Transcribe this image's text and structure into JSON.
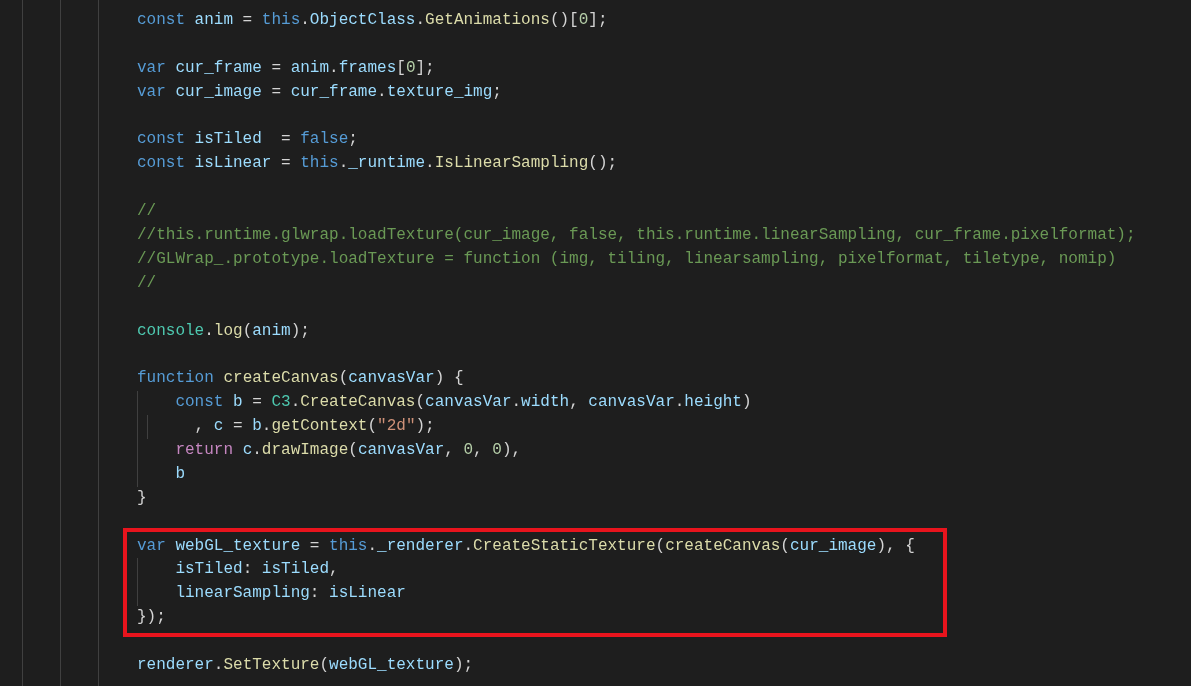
{
  "editor": {
    "blocks": [
      {
        "highlighted": false,
        "lines": [
          {
            "tokens": [
              {
                "kind": "kw",
                "text": "const "
              },
              {
                "kind": "var",
                "text": "anim"
              },
              {
                "kind": "p",
                "text": " = "
              },
              {
                "kind": "kw",
                "text": "this"
              },
              {
                "kind": "p",
                "text": "."
              },
              {
                "kind": "var",
                "text": "ObjectClass"
              },
              {
                "kind": "p",
                "text": "."
              },
              {
                "kind": "fn",
                "text": "GetAnimations"
              },
              {
                "kind": "p",
                "text": "()["
              },
              {
                "kind": "num",
                "text": "0"
              },
              {
                "kind": "p",
                "text": "];"
              }
            ]
          }
        ]
      },
      {
        "highlighted": false,
        "lines": [
          {
            "tokens": [
              {
                "kind": "kw",
                "text": "var "
              },
              {
                "kind": "var",
                "text": "cur_frame"
              },
              {
                "kind": "p",
                "text": " = "
              },
              {
                "kind": "var",
                "text": "anim"
              },
              {
                "kind": "p",
                "text": "."
              },
              {
                "kind": "var",
                "text": "frames"
              },
              {
                "kind": "p",
                "text": "["
              },
              {
                "kind": "num",
                "text": "0"
              },
              {
                "kind": "p",
                "text": "];"
              }
            ]
          },
          {
            "tokens": [
              {
                "kind": "kw",
                "text": "var "
              },
              {
                "kind": "var",
                "text": "cur_image"
              },
              {
                "kind": "p",
                "text": " = "
              },
              {
                "kind": "var",
                "text": "cur_frame"
              },
              {
                "kind": "p",
                "text": "."
              },
              {
                "kind": "var",
                "text": "texture_img"
              },
              {
                "kind": "p",
                "text": ";"
              }
            ]
          }
        ]
      },
      {
        "highlighted": false,
        "lines": [
          {
            "tokens": [
              {
                "kind": "kw",
                "text": "const "
              },
              {
                "kind": "var",
                "text": "isTiled"
              },
              {
                "kind": "p",
                "text": "  = "
              },
              {
                "kind": "kw",
                "text": "false"
              },
              {
                "kind": "p",
                "text": ";"
              }
            ]
          },
          {
            "tokens": [
              {
                "kind": "kw",
                "text": "const "
              },
              {
                "kind": "var",
                "text": "isLinear"
              },
              {
                "kind": "p",
                "text": " = "
              },
              {
                "kind": "kw",
                "text": "this"
              },
              {
                "kind": "p",
                "text": "."
              },
              {
                "kind": "var",
                "text": "_runtime"
              },
              {
                "kind": "p",
                "text": "."
              },
              {
                "kind": "fn",
                "text": "IsLinearSampling"
              },
              {
                "kind": "p",
                "text": "();"
              }
            ]
          }
        ]
      },
      {
        "highlighted": false,
        "lines": [
          {
            "tokens": [
              {
                "kind": "cmt",
                "text": "//"
              }
            ]
          },
          {
            "tokens": [
              {
                "kind": "cmt",
                "text": "//this.runtime.glwrap.loadTexture(cur_image, false, this.runtime.linearSampling, cur_frame.pixelformat);"
              }
            ]
          },
          {
            "tokens": [
              {
                "kind": "cmt",
                "text": "//GLWrap_.prototype.loadTexture = function (img, tiling, linearsampling, pixelformat, tiletype, nomip)"
              }
            ]
          },
          {
            "tokens": [
              {
                "kind": "cmt",
                "text": "//"
              }
            ]
          }
        ]
      },
      {
        "highlighted": false,
        "lines": [
          {
            "tokens": [
              {
                "kind": "type",
                "text": "console"
              },
              {
                "kind": "p",
                "text": "."
              },
              {
                "kind": "fn",
                "text": "log"
              },
              {
                "kind": "p",
                "text": "("
              },
              {
                "kind": "var",
                "text": "anim"
              },
              {
                "kind": "p",
                "text": ");"
              }
            ]
          }
        ]
      },
      {
        "highlighted": false,
        "lines": [
          {
            "tokens": [
              {
                "kind": "kw",
                "text": "function "
              },
              {
                "kind": "fn",
                "text": "createCanvas"
              },
              {
                "kind": "p",
                "text": "("
              },
              {
                "kind": "var",
                "text": "canvasVar"
              },
              {
                "kind": "p",
                "text": ") {"
              }
            ]
          },
          {
            "tokens": [
              {
                "kind": "kw",
                "text": "    const "
              },
              {
                "kind": "var",
                "text": "b"
              },
              {
                "kind": "p",
                "text": " = "
              },
              {
                "kind": "type",
                "text": "C3"
              },
              {
                "kind": "p",
                "text": "."
              },
              {
                "kind": "fn",
                "text": "CreateCanvas"
              },
              {
                "kind": "p",
                "text": "("
              },
              {
                "kind": "var",
                "text": "canvasVar"
              },
              {
                "kind": "p",
                "text": "."
              },
              {
                "kind": "var",
                "text": "width"
              },
              {
                "kind": "p",
                "text": ", "
              },
              {
                "kind": "var",
                "text": "canvasVar"
              },
              {
                "kind": "p",
                "text": "."
              },
              {
                "kind": "var",
                "text": "height"
              },
              {
                "kind": "p",
                "text": ")"
              }
            ]
          },
          {
            "tokens": [
              {
                "kind": "p",
                "text": "      , "
              },
              {
                "kind": "var",
                "text": "c"
              },
              {
                "kind": "p",
                "text": " = "
              },
              {
                "kind": "var",
                "text": "b"
              },
              {
                "kind": "p",
                "text": "."
              },
              {
                "kind": "fn",
                "text": "getContext"
              },
              {
                "kind": "p",
                "text": "("
              },
              {
                "kind": "str",
                "text": "\"2d\""
              },
              {
                "kind": "p",
                "text": ");"
              }
            ]
          },
          {
            "tokens": [
              {
                "kind": "ctl",
                "text": "    return "
              },
              {
                "kind": "var",
                "text": "c"
              },
              {
                "kind": "p",
                "text": "."
              },
              {
                "kind": "fn",
                "text": "drawImage"
              },
              {
                "kind": "p",
                "text": "("
              },
              {
                "kind": "var",
                "text": "canvasVar"
              },
              {
                "kind": "p",
                "text": ", "
              },
              {
                "kind": "num",
                "text": "0"
              },
              {
                "kind": "p",
                "text": ", "
              },
              {
                "kind": "num",
                "text": "0"
              },
              {
                "kind": "p",
                "text": "),"
              }
            ]
          },
          {
            "tokens": [
              {
                "kind": "var",
                "text": "    b"
              }
            ]
          },
          {
            "tokens": [
              {
                "kind": "p",
                "text": "}"
              }
            ]
          }
        ]
      },
      {
        "highlighted": true,
        "lines": [
          {
            "tokens": [
              {
                "kind": "kw",
                "text": "var "
              },
              {
                "kind": "var",
                "text": "webGL_texture"
              },
              {
                "kind": "p",
                "text": " = "
              },
              {
                "kind": "kw",
                "text": "this"
              },
              {
                "kind": "p",
                "text": "."
              },
              {
                "kind": "var",
                "text": "_renderer"
              },
              {
                "kind": "p",
                "text": "."
              },
              {
                "kind": "fn",
                "text": "CreateStaticTexture"
              },
              {
                "kind": "p",
                "text": "("
              },
              {
                "kind": "fn",
                "text": "createCanvas"
              },
              {
                "kind": "p",
                "text": "("
              },
              {
                "kind": "var",
                "text": "cur_image"
              },
              {
                "kind": "p",
                "text": "), {"
              }
            ]
          },
          {
            "tokens": [
              {
                "kind": "var",
                "text": "    isTiled"
              },
              {
                "kind": "p",
                "text": ": "
              },
              {
                "kind": "var",
                "text": "isTiled"
              },
              {
                "kind": "p",
                "text": ","
              }
            ]
          },
          {
            "tokens": [
              {
                "kind": "var",
                "text": "    linearSampling"
              },
              {
                "kind": "p",
                "text": ": "
              },
              {
                "kind": "var",
                "text": "isLinear"
              }
            ]
          },
          {
            "tokens": [
              {
                "kind": "p",
                "text": "});"
              }
            ]
          }
        ]
      },
      {
        "highlighted": false,
        "lines": [
          {
            "tokens": [
              {
                "kind": "var",
                "text": "renderer"
              },
              {
                "kind": "p",
                "text": "."
              },
              {
                "kind": "fn",
                "text": "SetTexture"
              },
              {
                "kind": "p",
                "text": "("
              },
              {
                "kind": "var",
                "text": "webGL_texture"
              },
              {
                "kind": "p",
                "text": ");"
              }
            ]
          }
        ]
      }
    ]
  }
}
